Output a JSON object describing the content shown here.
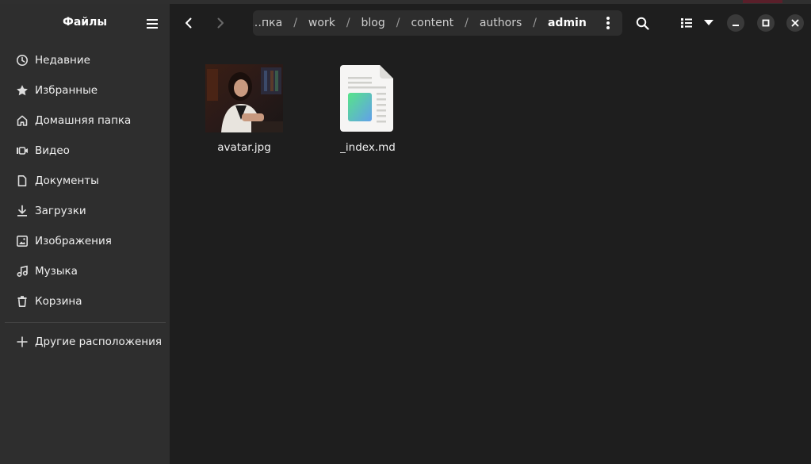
{
  "sidebar": {
    "title": "Файлы",
    "items": [
      {
        "label": "Недавние",
        "icon": "clock-icon"
      },
      {
        "label": "Избранные",
        "icon": "star-icon"
      },
      {
        "label": "Домашняя папка",
        "icon": "home-icon"
      },
      {
        "label": "Видео",
        "icon": "video-icon"
      },
      {
        "label": "Документы",
        "icon": "document-icon"
      },
      {
        "label": "Загрузки",
        "icon": "download-icon"
      },
      {
        "label": "Изображения",
        "icon": "image-icon"
      },
      {
        "label": "Музыка",
        "icon": "music-icon"
      },
      {
        "label": "Корзина",
        "icon": "trash-icon"
      }
    ],
    "other_locations": {
      "label": "Другие расположения",
      "icon": "plus-icon"
    }
  },
  "pathbar": {
    "crumbs": [
      "…пка",
      "work",
      "blog",
      "content",
      "authors",
      "admin"
    ],
    "separator": "/"
  },
  "files": [
    {
      "name": "avatar.jpg",
      "kind": "image"
    },
    {
      "name": "_index.md",
      "kind": "text-document"
    }
  ],
  "colors": {
    "sidebar_bg": "#2e2e2e",
    "content_bg": "#1e1e1e",
    "pathbar_bg": "#2d2d2d"
  }
}
